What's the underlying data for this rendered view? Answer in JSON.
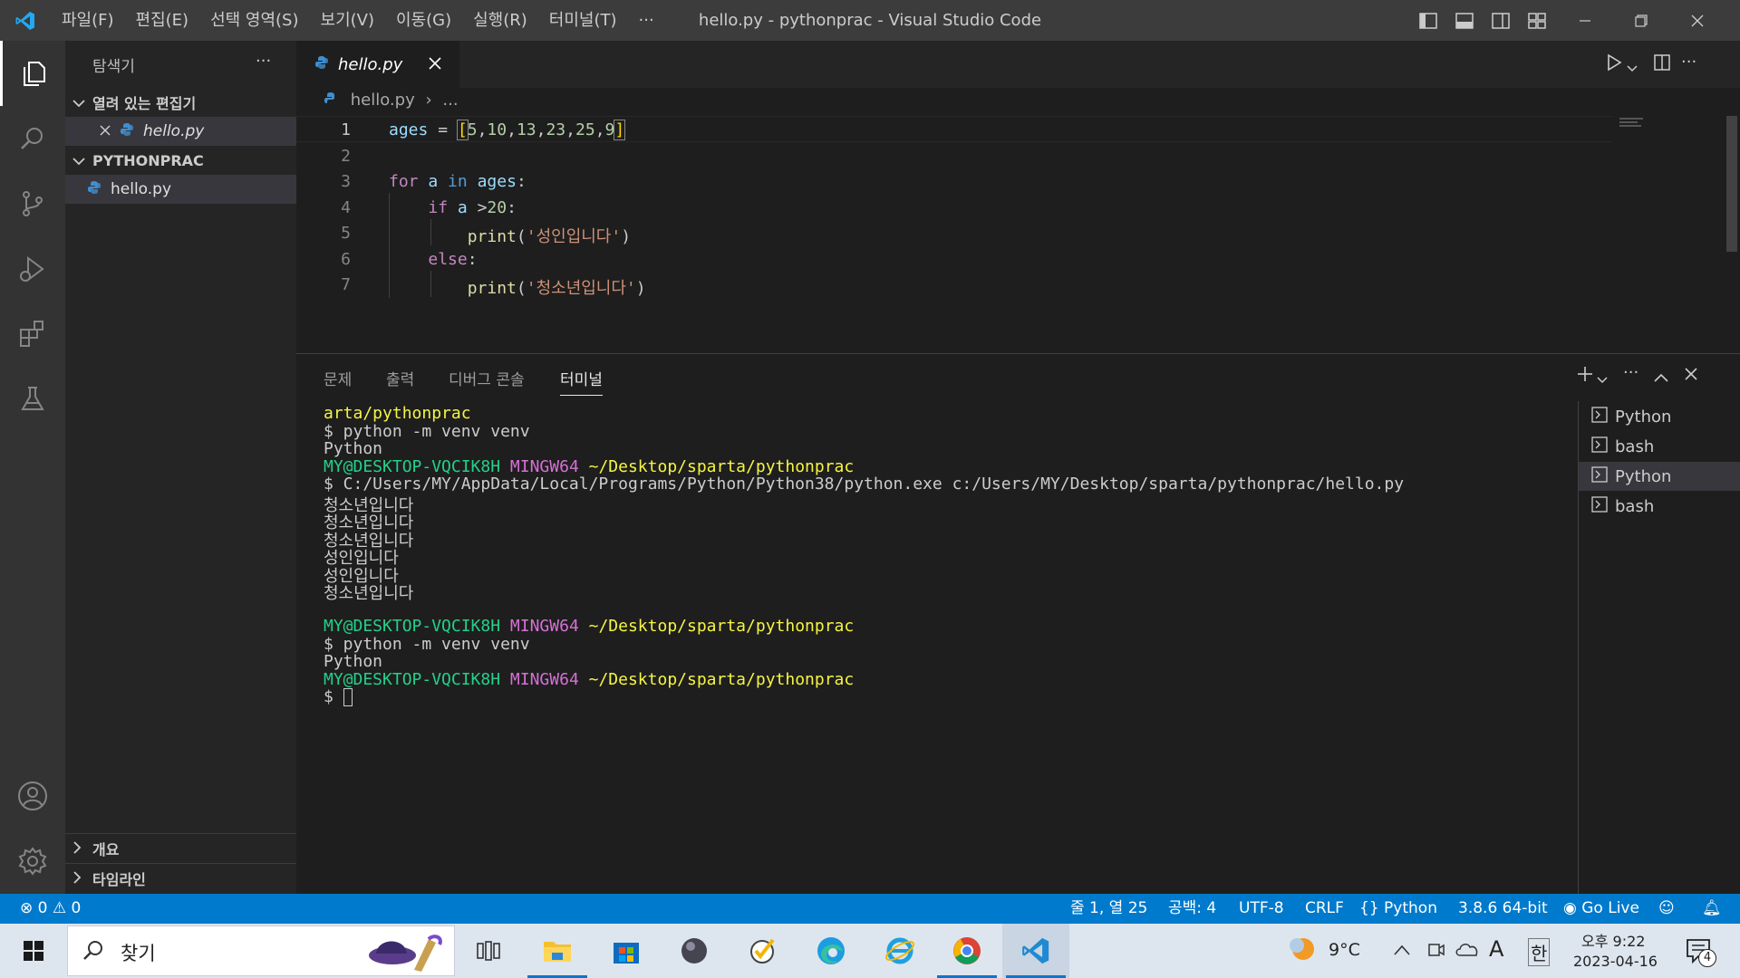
{
  "titlebar": {
    "menus": [
      "파일(F)",
      "편집(E)",
      "선택 영역(S)",
      "보기(V)",
      "이동(G)",
      "실행(R)",
      "터미널(T)",
      "···"
    ],
    "title": "hello.py - pythonprac - Visual Studio Code",
    "accent": "#007acc"
  },
  "sidebar": {
    "title": "탐색기",
    "more": "···",
    "open_editors_label": "열려 있는 편집기",
    "open_editor_file": "hello.py",
    "folder_label": "PYTHONPRAC",
    "files": [
      "hello.py"
    ],
    "outline_label": "개요",
    "timeline_label": "타임라인"
  },
  "editor": {
    "tab_label": "hello.py",
    "breadcrumb_file": "hello.py",
    "breadcrumb_rest": "...",
    "line_numbers": [
      "1",
      "2",
      "3",
      "4",
      "5",
      "6",
      "7"
    ]
  },
  "panel": {
    "tabs": [
      "문제",
      "출력",
      "디버그 콘솔",
      "터미널"
    ],
    "terminals": [
      "Python",
      "bash",
      "Python",
      "bash"
    ],
    "user": "MY@DESKTOP-VQCIK8H",
    "shell": "MINGW64",
    "path": "~/Desktop/sparta/pythonprac",
    "lines": {
      "l0": "arta/pythonprac",
      "l1": "$ python -m venv venv",
      "l2": "Python",
      "l4": "$ C:/Users/MY/AppData/Local/Programs/Python/Python38/python.exe c:/Users/MY/Desktop/sparta/pythonprac/hello.py",
      "out1": "청소년입니다",
      "out2": "청소년입니다",
      "out3": "청소년입니다",
      "out4": "성인입니다",
      "out5": "성인입니다",
      "out6": "청소년입니다",
      "l8": "$ python -m venv venv",
      "l9": "Python",
      "prompt": "$ "
    }
  },
  "statusbar": {
    "errors": "0",
    "warnings": "0",
    "position": "줄 1, 열 25",
    "spaces": "공백: 4",
    "encoding": "UTF-8",
    "eol": "CRLF",
    "language": "Python",
    "interpreter": "3.8.6 64-bit",
    "golive": "Go Live"
  },
  "taskbar": {
    "search_label": "찾기",
    "weather": "9°C",
    "ime": "A",
    "lang": "한",
    "time": "오후 9:22",
    "date": "2023-04-16",
    "notif_count": "4"
  }
}
